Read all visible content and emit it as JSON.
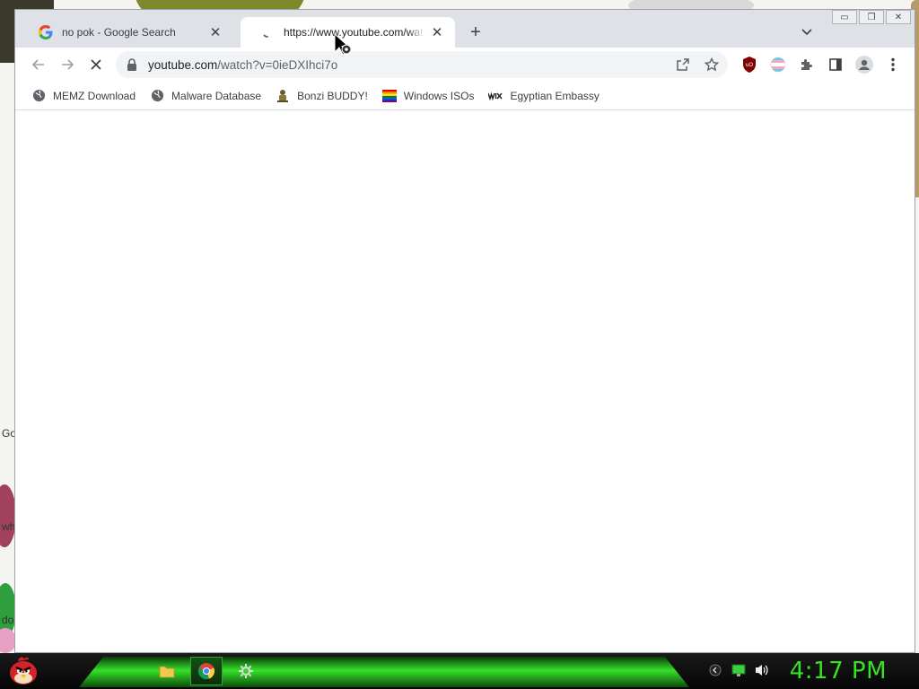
{
  "window": {
    "controls": {
      "minimize": "▭",
      "restore": "❐",
      "close": "✕"
    }
  },
  "tabs": [
    {
      "title": "no pok - Google Search",
      "favicon": "google-icon",
      "active": false
    },
    {
      "title": "https://www.youtube.com/watch",
      "favicon": "loading-icon",
      "active": true
    }
  ],
  "toolbar": {
    "url_host": "youtube.com",
    "url_path": "/watch?v=0ieDXIhci7o",
    "loading": true
  },
  "bookmarks": [
    {
      "label": "MEMZ Download",
      "icon": "globe-icon"
    },
    {
      "label": "Malware Database",
      "icon": "globe-icon"
    },
    {
      "label": "Bonzi BUDDY!",
      "icon": "bonzi-icon"
    },
    {
      "label": "Windows ISOs",
      "icon": "rainbow-flag-icon"
    },
    {
      "label": "Egyptian Embassy",
      "icon": "wix-icon"
    }
  ],
  "wallpaper_text": {
    "t1": "Go",
    "t2": "wh",
    "t3": "do"
  },
  "taskbar": {
    "clock": "4:17 PM",
    "accent_color": "#35e324"
  }
}
